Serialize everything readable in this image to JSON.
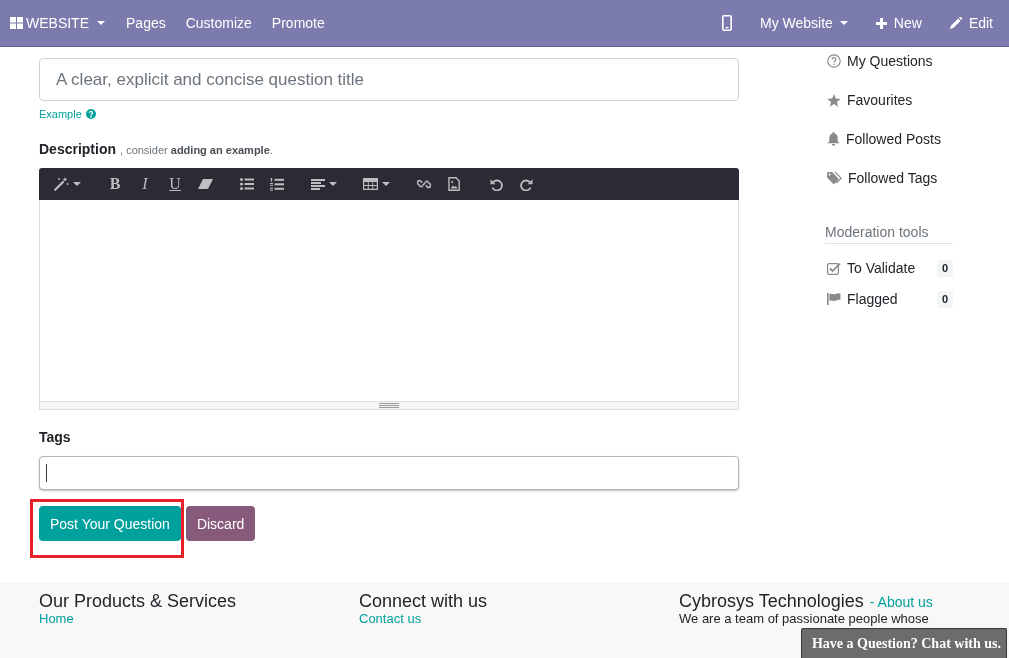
{
  "navbar": {
    "apps_menu": {
      "label": "WEBSITE",
      "dropdown": true
    },
    "menu": [
      "Pages",
      "Customize",
      "Promote"
    ],
    "right": [
      {
        "kind": "mobile_preview",
        "dropdown": false
      },
      {
        "kind": "switcher",
        "label": "My Website",
        "dropdown": true
      },
      {
        "kind": "new",
        "label": "New",
        "dropdown": false
      },
      {
        "kind": "edit",
        "label": "Edit",
        "dropdown": false
      }
    ]
  },
  "form": {
    "title_field": {
      "placeholder": "A clear, explicit and concise question title"
    },
    "example_link": "Example",
    "description": {
      "label": "Description",
      "hint": ", consider **adding an example**."
    },
    "editor": {
      "toolbar": [
        {
          "buttons": [
            {
              "kind": "style",
              "dropdown": true
            }
          ]
        },
        {
          "buttons": [
            {
              "kind": "bold",
              "glyph": "B",
              "dropdown": false
            },
            {
              "kind": "italic",
              "glyph": "I",
              "dropdown": false
            },
            {
              "kind": "underline",
              "glyph": "U",
              "dropdown": false
            },
            {
              "kind": "eraser",
              "dropdown": false
            }
          ]
        },
        {
          "buttons": [
            {
              "kind": "bullets",
              "dropdown": false
            },
            {
              "kind": "numbers",
              "dropdown": false
            }
          ]
        },
        {
          "buttons": [
            {
              "kind": "align",
              "dropdown": true
            }
          ]
        },
        {
          "buttons": [
            {
              "kind": "table",
              "dropdown": true
            }
          ]
        },
        {
          "buttons": [
            {
              "kind": "link",
              "dropdown": false
            },
            {
              "kind": "picture",
              "dropdown": false
            }
          ]
        },
        {
          "buttons": [
            {
              "kind": "undo",
              "dropdown": false
            },
            {
              "kind": "redo",
              "dropdown": false
            }
          ]
        }
      ]
    },
    "tags": {
      "label": "Tags",
      "focused": true
    },
    "buttons": [
      {
        "kind": "submit",
        "label": "Post Your Question",
        "highlighted": true
      },
      {
        "kind": "cancel",
        "label": "Discard",
        "highlighted": false
      }
    ]
  },
  "sidebar": {
    "links": [
      {
        "kind": "questions",
        "label": "My Questions"
      },
      {
        "kind": "favourites",
        "label": "Favourites"
      },
      {
        "kind": "posts",
        "label": "Followed Posts"
      },
      {
        "kind": "tags",
        "label": "Followed Tags"
      }
    ],
    "moderation": {
      "title": "Moderation tools",
      "items": [
        {
          "kind": "validate",
          "label": "To Validate",
          "count": "0"
        },
        {
          "kind": "flagged",
          "label": "Flagged",
          "count": "0"
        }
      ]
    }
  },
  "footer": {
    "columns": [
      {
        "title": "Our Products & Services",
        "links": [
          "Home"
        ]
      },
      {
        "title": "Connect with us",
        "links": [
          "Contact us"
        ]
      },
      {
        "title": "Cybrosys Technologies",
        "title_link": "- About us",
        "text": "We are a team of passionate people whose"
      }
    ]
  },
  "chat_button": {
    "label": "Have a Question? Chat with us."
  }
}
